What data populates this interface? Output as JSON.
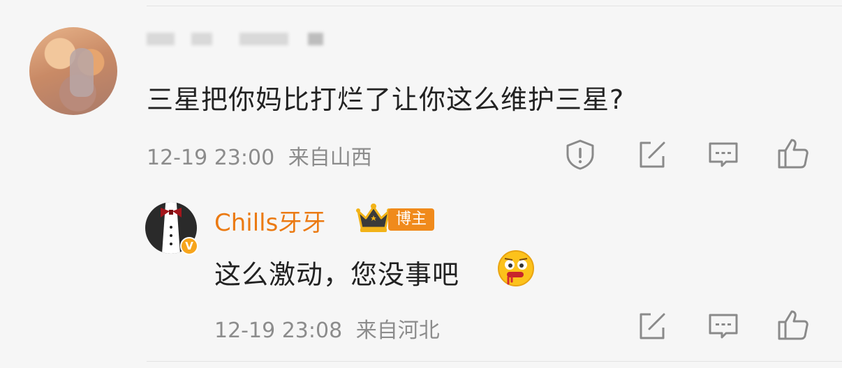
{
  "comment": {
    "username_obscured": "",
    "text": "三星把你妈比打烂了让你这么维护三星?",
    "timestamp": "12-19 23:00",
    "location": "来自山西",
    "actions": [
      "report-icon",
      "repost-icon",
      "comment-icon",
      "like-icon"
    ]
  },
  "reply": {
    "username": "Chills牙牙",
    "badge": "博主",
    "text": "这么激动，您没事吧",
    "verified_mark": "V",
    "timestamp": "12-19 23:08",
    "location": "来自河北",
    "actions": [
      "repost-icon",
      "comment-icon",
      "like-icon"
    ]
  },
  "colors": {
    "accent_name": "#eb7a12",
    "badge_bg": "#f08a1b",
    "meta_text": "#8c8c8c",
    "body_text": "#222222",
    "background": "#f6f6f6"
  }
}
